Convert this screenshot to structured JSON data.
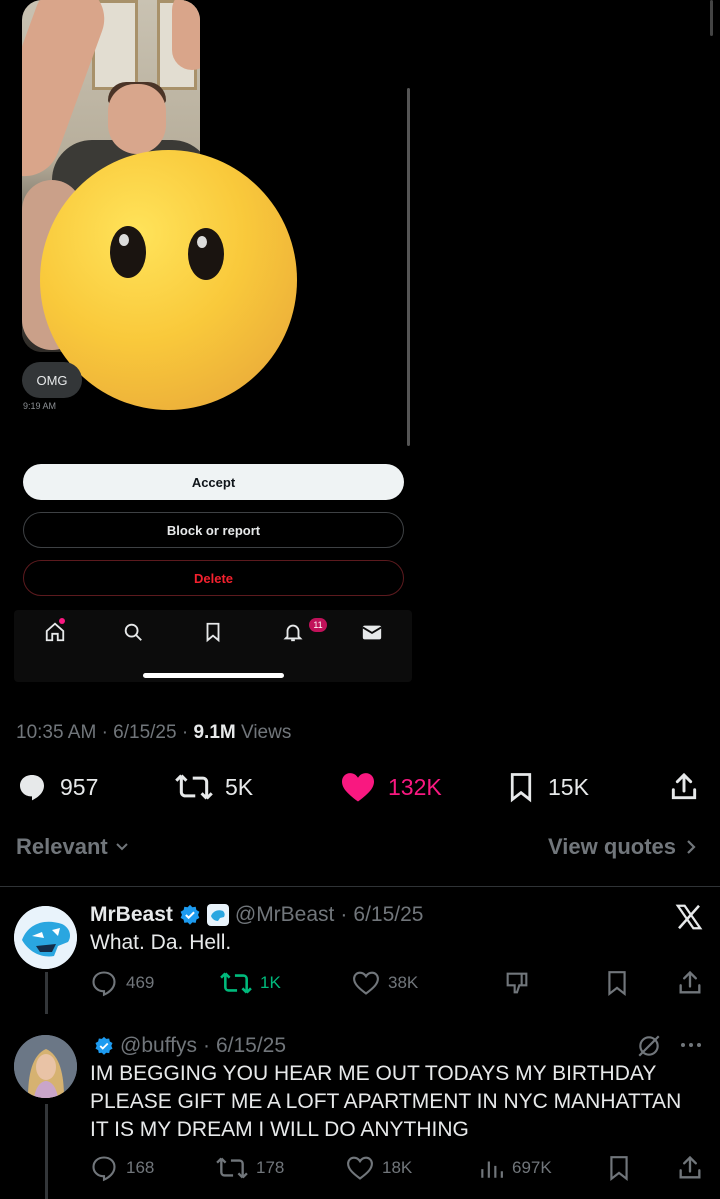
{
  "dm_preview": {
    "bubble_text": "OMG",
    "timestamp": "9:19 AM",
    "accept_label": "Accept",
    "block_label": "Block or report",
    "delete_label": "Delete",
    "notification_count": "11"
  },
  "post_meta": {
    "time": "10:35 AM",
    "date": "6/15/25",
    "views_count": "9.1M",
    "views_label": "Views"
  },
  "post_actions": {
    "replies": "957",
    "reposts": "5K",
    "likes": "132K",
    "bookmarks": "15K"
  },
  "colors": {
    "like": "#f91880",
    "repost_active": "#00ba7c",
    "verified": "#1d9bf0",
    "delete": "#f4212e"
  },
  "sort": {
    "label": "Relevant",
    "view_quotes": "View quotes"
  },
  "replies": [
    {
      "name": "MrBeast",
      "handle": "@MrBeast",
      "date": "6/15/25",
      "text": "What. Da. Hell.",
      "replies": "469",
      "reposts": "1K",
      "likes": "38K"
    },
    {
      "name": "",
      "handle": "@buffys",
      "date": "6/15/25",
      "text": "IM BEGGING YOU HEAR ME OUT TODAYS MY BIRTHDAY PLEASE GIFT ME A LOFT APARTMENT IN NYC MANHATTAN IT IS MY DREAM I WILL DO ANYTHING",
      "replies": "168",
      "reposts": "178",
      "likes": "18K",
      "views": "697K"
    }
  ],
  "icons": [
    "home-icon",
    "search-icon",
    "bookmark-icon",
    "bell-icon",
    "mail-icon",
    "reply-icon",
    "repost-icon",
    "heart-icon",
    "share-icon",
    "chevron-down-icon",
    "chevron-right-icon",
    "verified-icon",
    "x-logo-icon",
    "grok-icon",
    "more-icon",
    "views-icon",
    "dislike-icon"
  ]
}
